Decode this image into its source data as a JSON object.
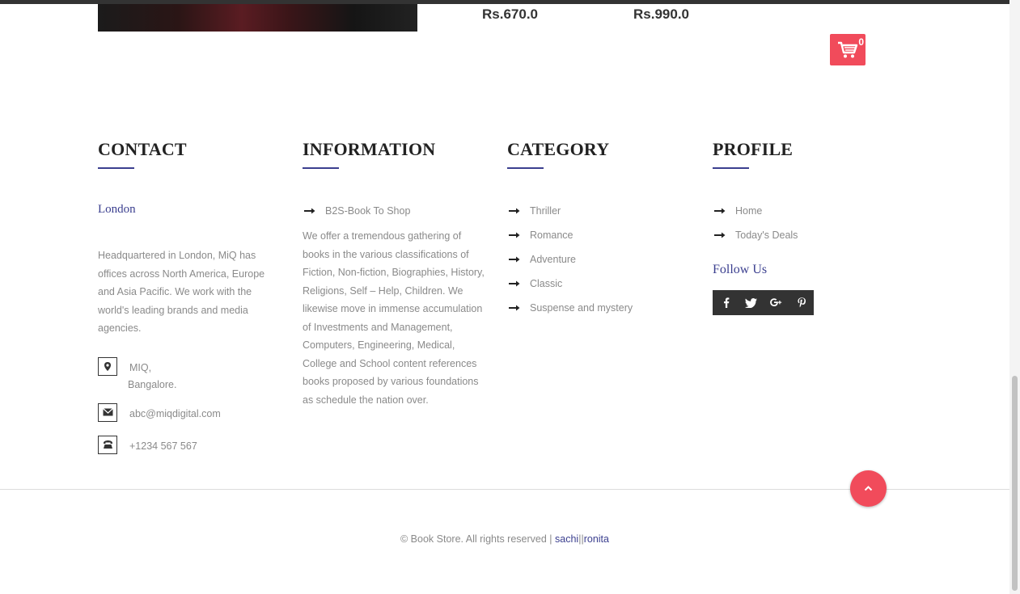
{
  "products": {
    "price_1": "Rs.670.0",
    "price_2": "Rs.990.0"
  },
  "cart": {
    "count": "0",
    "icon": "shopping-cart-icon"
  },
  "contact": {
    "title": "CONTACT",
    "city": "London",
    "description": "Headquartered in London, MiQ has offices across North America, Europe and Asia Pacific. We work with the world's leading brands and media agencies.",
    "address_line1": "MIQ,",
    "address_line2": "Bangalore.",
    "email": "abc@miqdigital.com",
    "phone": "+1234 567 567"
  },
  "information": {
    "title": "INFORMATION",
    "link": "B2S-Book To Shop",
    "description": "We offer a tremendous gathering of books in the various classifications of Fiction, Non-fiction, Biographies, History, Religions, Self – Help, Children. We likewise move in immense accumulation of Investments and Management, Computers, Engineering, Medical, College and School content references books proposed by various foundations as schedule the nation over."
  },
  "category": {
    "title": "CATEGORY",
    "items": [
      "Thriller",
      "Romance",
      "Adventure",
      "Classic",
      "Suspense and mystery"
    ]
  },
  "profile": {
    "title": "PROFILE",
    "items": [
      "Home",
      "Today's Deals"
    ],
    "follow_title": "Follow Us",
    "social": [
      "facebook-icon",
      "twitter-icon",
      "google-plus-icon",
      "pinterest-icon"
    ]
  },
  "footer": {
    "copyright": "© Book Store. All rights reserved | ",
    "author_1": "sachi",
    "separator": "||",
    "author_2": "ronita"
  },
  "colors": {
    "accent_red": "#f14b5b",
    "accent_blue": "#3b3f8f",
    "dark": "#333333"
  }
}
